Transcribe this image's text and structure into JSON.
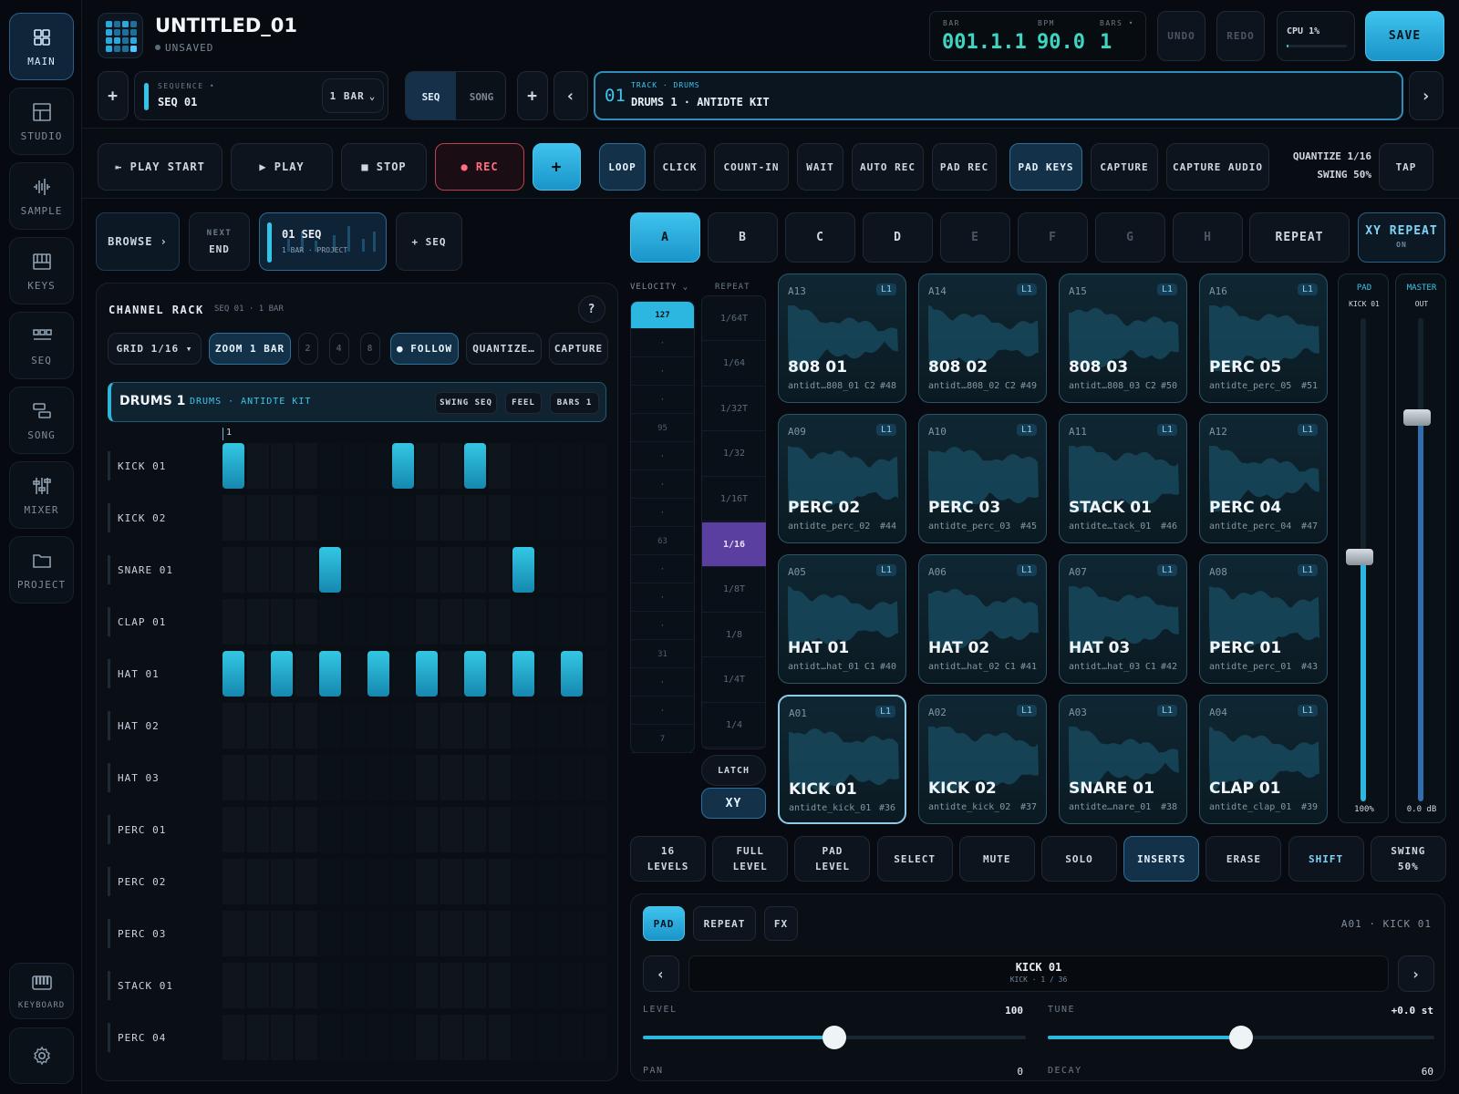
{
  "nav": {
    "items": [
      {
        "label": "MAIN",
        "icon": "grid-icon",
        "active": true
      },
      {
        "label": "STUDIO",
        "icon": "layout-icon",
        "active": false
      },
      {
        "label": "SAMPLE",
        "icon": "waveform-icon",
        "active": false
      },
      {
        "label": "KEYS",
        "icon": "piano-keys-icon",
        "active": false
      },
      {
        "label": "SEQ",
        "icon": "sequence-icon",
        "active": false
      },
      {
        "label": "SONG",
        "icon": "song-blocks-icon",
        "active": false
      },
      {
        "label": "MIXER",
        "icon": "mixer-sliders-icon",
        "active": false
      },
      {
        "label": "PROJECT",
        "icon": "folder-icon",
        "active": false
      }
    ],
    "keyboard_label": "KEYBOARD",
    "settings_icon": "gear-icon"
  },
  "header": {
    "title": "UNTITLED_01",
    "status": "UNSAVED",
    "transport_display": {
      "bar_label": "BAR",
      "bar_value": "001.1.1",
      "bpm_label": "BPM",
      "bpm_value": "90.0",
      "bars_label": "BARS •",
      "bars_value": "1"
    },
    "undo": "UNDO",
    "redo": "REDO",
    "cpu_label": "CPU 1%",
    "cpu_usage": 0.01,
    "save": "SAVE"
  },
  "sequence_bar": {
    "add": "+",
    "sequence_label": "SEQUENCE •",
    "sequence_name": "SEQ 01",
    "length": "1 BAR",
    "mode_seq": "SEQ",
    "mode_song": "SONG",
    "add2": "+",
    "prev": "‹",
    "next": "›",
    "track_number": "01",
    "track_label": "TRACK · DRUMS",
    "track_name": "DRUMS 1 · ANTIDTE KIT"
  },
  "transport": {
    "play_start": "⇤ PLAY START",
    "play": "▶ PLAY",
    "stop": "■ STOP",
    "rec": "● REC",
    "plus": "+",
    "loop": "LOOP",
    "click": "CLICK",
    "count_in": "COUNT-IN",
    "wait": "WAIT",
    "auto_rec": "AUTO REC",
    "pad_rec": "PAD REC",
    "pad_keys": "PAD KEYS",
    "capture": "CAPTURE",
    "capture_audio": "CAPTURE AUDIO",
    "quantize": "QUANTIZE 1/16",
    "swing": "SWING 50%",
    "tap": "TAP"
  },
  "seq_strip": {
    "browse": "BROWSE ›",
    "next_label": "NEXT",
    "next_value": "END",
    "seq_name": "01 SEQ",
    "seq_sub": "1 BAR · PROJECT",
    "add_seq": "+ SEQ"
  },
  "channel_rack": {
    "title": "CHANNEL RACK",
    "subtitle": "SEQ 01 · 1 BAR",
    "help": "?",
    "grid": "GRID 1/16 ▾",
    "zoom": "ZOOM 1 BAR",
    "zoom_opts": [
      "2",
      "4",
      "8"
    ],
    "follow": "● FOLLOW",
    "quantize": "QUANTIZE…",
    "capture": "CAPTURE",
    "track_name": "DRUMS 1",
    "track_sub": "DRUMS · ANTIDTE KIT",
    "swing_seq": "SWING SEQ",
    "feel": "FEEL",
    "bars": "BARS 1",
    "bar_marker": "1",
    "rows": [
      {
        "name": "KICK 01",
        "steps": [
          0,
          7,
          10
        ]
      },
      {
        "name": "KICK 02",
        "steps": []
      },
      {
        "name": "SNARE 01",
        "steps": [
          4,
          12
        ]
      },
      {
        "name": "CLAP 01",
        "steps": []
      },
      {
        "name": "HAT 01",
        "steps": [
          0,
          2,
          4,
          6,
          8,
          10,
          12,
          14
        ]
      },
      {
        "name": "HAT 02",
        "steps": []
      },
      {
        "name": "HAT 03",
        "steps": []
      },
      {
        "name": "PERC 01",
        "steps": []
      },
      {
        "name": "PERC 02",
        "steps": []
      },
      {
        "name": "PERC 03",
        "steps": []
      },
      {
        "name": "STACK 01",
        "steps": []
      },
      {
        "name": "PERC 04",
        "steps": []
      }
    ]
  },
  "banks": {
    "items": [
      "A",
      "B",
      "C",
      "D",
      "E",
      "F",
      "G",
      "H"
    ],
    "active": "A",
    "repeat": "REPEAT",
    "xy_repeat": "XY REPEAT",
    "xy_state": "ON"
  },
  "velocity": {
    "label": "VELOCITY ⌄",
    "cells": [
      "127",
      "·",
      "·",
      "·",
      "95",
      "·",
      "·",
      "·",
      "63",
      "·",
      "·",
      "·",
      "31",
      "·",
      "·",
      "7"
    ]
  },
  "repeat_col": {
    "label": "REPEAT",
    "rates": [
      "1/64T",
      "1/64",
      "1/32T",
      "1/32",
      "1/16T",
      "1/16",
      "1/8T",
      "1/8",
      "1/4T",
      "1/4"
    ],
    "active": "1/16",
    "latch": "LATCH",
    "xy": "XY"
  },
  "pads": [
    {
      "id": "A13",
      "layer": "L1",
      "name": "808 01",
      "file": "antidt…808_01",
      "note": "C2",
      "num": "#48"
    },
    {
      "id": "A14",
      "layer": "L1",
      "name": "808 02",
      "file": "antidt…808_02",
      "note": "C2",
      "num": "#49"
    },
    {
      "id": "A15",
      "layer": "L1",
      "name": "808 03",
      "file": "antidt…808_03",
      "note": "C2",
      "num": "#50"
    },
    {
      "id": "A16",
      "layer": "L1",
      "name": "PERC 05",
      "file": "antidte_perc_05",
      "note": "",
      "num": "#51"
    },
    {
      "id": "A09",
      "layer": "L1",
      "name": "PERC 02",
      "file": "antidte_perc_02",
      "note": "",
      "num": "#44"
    },
    {
      "id": "A10",
      "layer": "L1",
      "name": "PERC 03",
      "file": "antidte_perc_03",
      "note": "",
      "num": "#45"
    },
    {
      "id": "A11",
      "layer": "L1",
      "name": "STACK 01",
      "file": "antidte…tack_01",
      "note": "",
      "num": "#46"
    },
    {
      "id": "A12",
      "layer": "L1",
      "name": "PERC 04",
      "file": "antidte_perc_04",
      "note": "",
      "num": "#47"
    },
    {
      "id": "A05",
      "layer": "L1",
      "name": "HAT 01",
      "file": "antidt…hat_01",
      "note": "C1",
      "num": "#40"
    },
    {
      "id": "A06",
      "layer": "L1",
      "name": "HAT 02",
      "file": "antidt…hat_02",
      "note": "C1",
      "num": "#41"
    },
    {
      "id": "A07",
      "layer": "L1",
      "name": "HAT 03",
      "file": "antidt…hat_03",
      "note": "C1",
      "num": "#42"
    },
    {
      "id": "A08",
      "layer": "L1",
      "name": "PERC 01",
      "file": "antidte_perc_01",
      "note": "",
      "num": "#43"
    },
    {
      "id": "A01",
      "layer": "L1",
      "name": "KICK 01",
      "file": "antidte_kick_01",
      "note": "",
      "num": "#36"
    },
    {
      "id": "A02",
      "layer": "L1",
      "name": "KICK 02",
      "file": "antidte_kick_02",
      "note": "",
      "num": "#37"
    },
    {
      "id": "A03",
      "layer": "L1",
      "name": "SNARE 01",
      "file": "antidte…nare_01",
      "note": "",
      "num": "#38"
    },
    {
      "id": "A04",
      "layer": "L1",
      "name": "CLAP 01",
      "file": "antidte_clap_01",
      "note": "",
      "num": "#39"
    }
  ],
  "faders": {
    "pad_label": "PAD",
    "pad_target": "KICK 01",
    "pad_value": "100%",
    "pad_level": 1.0,
    "master_label": "MASTER",
    "master_target": "OUT",
    "master_value": "0.0 dB"
  },
  "pad_funcs": {
    "items": [
      {
        "label": "16\nLEVELS",
        "active": false
      },
      {
        "label": "FULL\nLEVEL",
        "active": false
      },
      {
        "label": "PAD\nLEVEL",
        "active": false
      },
      {
        "label": "SELECT",
        "active": false
      },
      {
        "label": "MUTE",
        "active": false
      },
      {
        "label": "SOLO",
        "active": false
      },
      {
        "label": "INSERTS",
        "active": true
      },
      {
        "label": "ERASE",
        "active": false
      },
      {
        "label": "SHIFT",
        "active": false
      },
      {
        "label": "SWING\n50%",
        "active": false
      }
    ]
  },
  "pad_editor": {
    "tabs": [
      "PAD",
      "REPEAT",
      "FX"
    ],
    "active_tab": "PAD",
    "selection": "A01 · KICK 01",
    "sample_name": "KICK 01",
    "sample_sub": "KICK · 1 / 36",
    "level_label": "LEVEL",
    "level_value": "100",
    "level": 0.5,
    "tune_label": "TUNE",
    "tune_value": "+0.0 st",
    "tune": 0.5,
    "pan_label": "PAN",
    "pan_value": "0",
    "decay_label": "DECAY",
    "decay_value": "60"
  },
  "colors": {
    "accent": "#2bb7e0",
    "rec": "#e04a5a",
    "repeat_active": "#5b3fa0",
    "background": "#070b11"
  }
}
